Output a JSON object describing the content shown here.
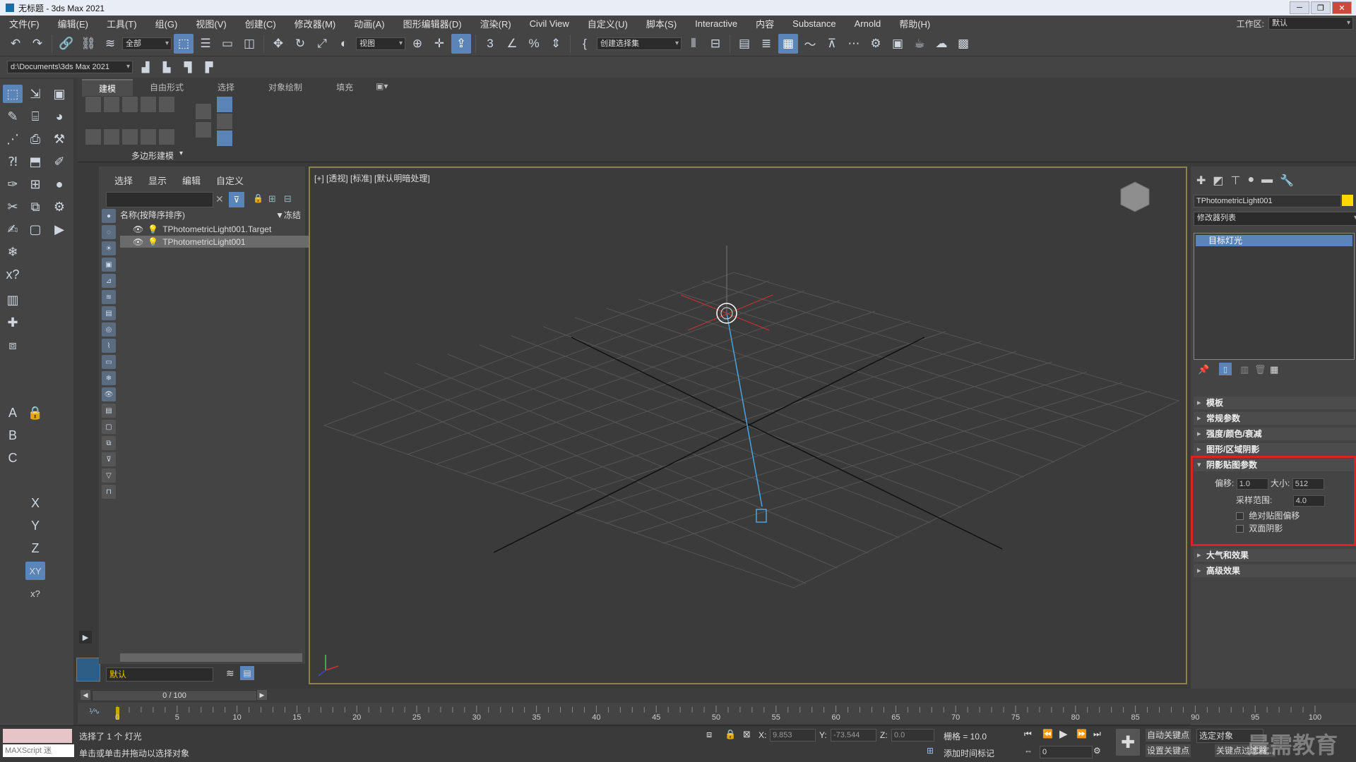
{
  "window": {
    "title": "无标题 - 3ds Max 2021"
  },
  "menu": [
    "文件(F)",
    "编辑(E)",
    "工具(T)",
    "组(G)",
    "视图(V)",
    "创建(C)",
    "修改器(M)",
    "动画(A)",
    "图形编辑器(D)",
    "渲染(R)",
    "Civil View",
    "自定义(U)",
    "脚本(S)",
    "Interactive",
    "内容",
    "Substance",
    "Arnold",
    "帮助(H)"
  ],
  "workspace": {
    "label": "工作区:",
    "value": "默认"
  },
  "toolbar": {
    "filter": "全部",
    "view": "视图",
    "selection_set": "创建选择集"
  },
  "project_path": "d:\\Documents\\3ds Max 2021",
  "ribbon": {
    "tabs": [
      "建模",
      "自由形式",
      "选择",
      "对象绘制",
      "填充"
    ],
    "group": "多边形建模"
  },
  "explorer": {
    "tabs": [
      "选择",
      "显示",
      "编辑",
      "自定义"
    ],
    "column_name": "名称(按降序排序)",
    "column_frozen": "▼冻结",
    "items": [
      "TPhotometricLight001.Target",
      "TPhotometricLight001"
    ],
    "layer": "默认"
  },
  "viewport": {
    "label": "[+] [透视] [标准] [默认明暗处理]"
  },
  "command_panel": {
    "object_name": "TPhotometricLight001",
    "object_color": "#ffd800",
    "modifier_list": "修改器列表",
    "stack_item": "目标灯光",
    "rollouts": [
      "模板",
      "常规参数",
      "强度/颜色/衰减",
      "图形/区域阴影",
      "阴影贴图参数",
      "大气和效果",
      "高级效果"
    ],
    "shadow_map": {
      "bias_label": "偏移:",
      "bias": "1.0",
      "size_label": "大小:",
      "size": "512",
      "sample_label": "采样范围:",
      "sample": "4.0",
      "abs_bias": "绝对贴图偏移",
      "two_sided": "双面阴影"
    }
  },
  "time": {
    "frame": "0 / 100",
    "ticks": [
      "0",
      "5",
      "10",
      "15",
      "20",
      "25",
      "30",
      "35",
      "40",
      "45",
      "50",
      "55",
      "60",
      "65",
      "70",
      "75",
      "80",
      "85",
      "90",
      "95",
      "100"
    ]
  },
  "status": {
    "maxscript": "MAXScript 迷",
    "selected": "选择了 1 个 灯光",
    "hint": "单击或单击并拖动以选择对象",
    "x_label": "X:",
    "x": "9.853",
    "y_label": "Y:",
    "y": "-73.544",
    "z_label": "Z:",
    "z": "0.0",
    "grid": "栅格 = 10.0",
    "add_time_tag": "添加时间标记",
    "auto_key": "自动关键点",
    "set_key": "设置关键点",
    "selected_obj": "选定对象",
    "key_filters": "关键点过滤器...",
    "frame_field": "0"
  },
  "watermark": "晨需教育"
}
